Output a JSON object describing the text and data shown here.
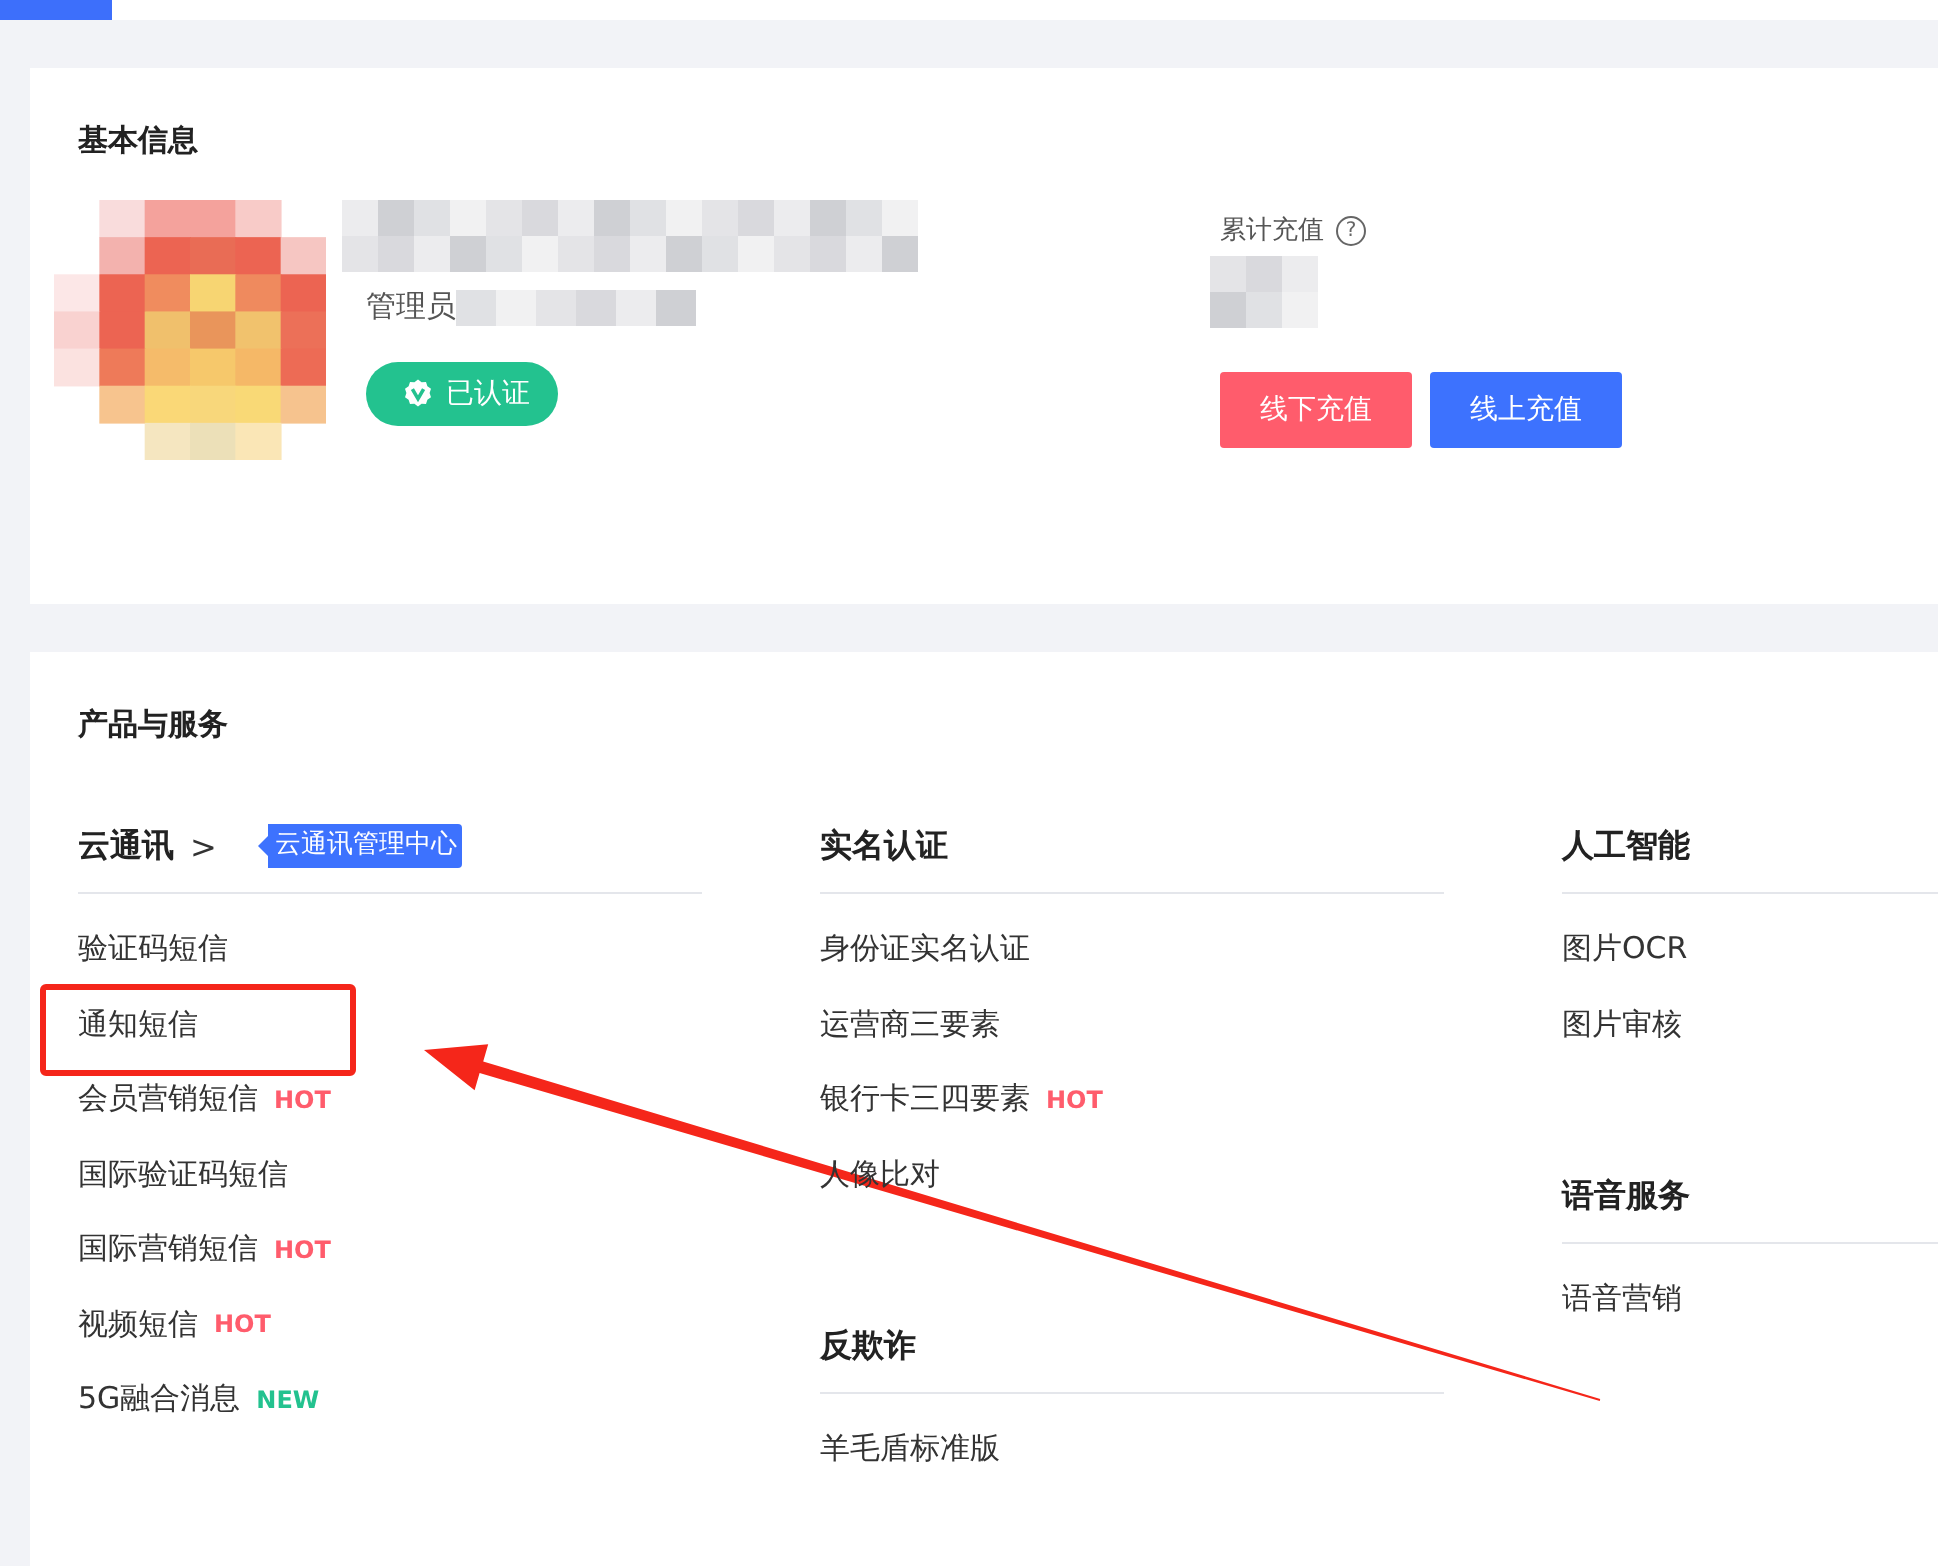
{
  "basic_info": {
    "title": "基本信息",
    "role_label": "管理员",
    "verified_badge": "已认证",
    "recharge": {
      "label": "累计充值",
      "help_icon": "?",
      "buttons": [
        {
          "label": "线下充值",
          "kind": "offline"
        },
        {
          "label": "线上充值",
          "kind": "online"
        }
      ]
    }
  },
  "products": {
    "title": "产品与服务",
    "annotation": {
      "arrow": true
    },
    "columns": [
      {
        "groups": [
          {
            "title": "云通讯",
            "title_arrow": ">",
            "tooltip": "云通讯管理中心",
            "items": [
              {
                "label": "验证码短信",
                "highlighted": false
              },
              {
                "label": "通知短信",
                "highlighted": true
              },
              {
                "label": "会员营销短信",
                "highlighted": false,
                "tag": {
                  "text": "HOT",
                  "kind": "hot"
                }
              },
              {
                "label": "国际验证码短信",
                "highlighted": false
              },
              {
                "label": "国际营销短信",
                "highlighted": false,
                "tag": {
                  "text": "HOT",
                  "kind": "hot"
                }
              },
              {
                "label": "视频短信",
                "highlighted": false,
                "tag": {
                  "text": "HOT",
                  "kind": "hot"
                }
              },
              {
                "label": "5G融合消息",
                "highlighted": false,
                "tag": {
                  "text": "NEW",
                  "kind": "new"
                }
              }
            ]
          }
        ]
      },
      {
        "groups": [
          {
            "title": "实名认证",
            "items": [
              {
                "label": "身份证实名认证",
                "highlighted": false
              },
              {
                "label": "运营商三要素",
                "highlighted": false
              },
              {
                "label": "银行卡三四要素",
                "highlighted": false,
                "tag": {
                  "text": "HOT",
                  "kind": "hot"
                }
              },
              {
                "label": "人像比对",
                "highlighted": false
              }
            ]
          },
          {
            "title": "反欺诈",
            "items": [
              {
                "label": "羊毛盾标准版",
                "highlighted": false
              }
            ]
          }
        ]
      },
      {
        "groups": [
          {
            "title": "人工智能",
            "items": [
              {
                "label": "图片OCR",
                "highlighted": false
              },
              {
                "label": "图片审核",
                "highlighted": false
              }
            ]
          },
          {
            "title": "语音服务",
            "items": [
              {
                "label": "语音营销",
                "highlighted": false
              }
            ]
          }
        ]
      }
    ]
  }
}
